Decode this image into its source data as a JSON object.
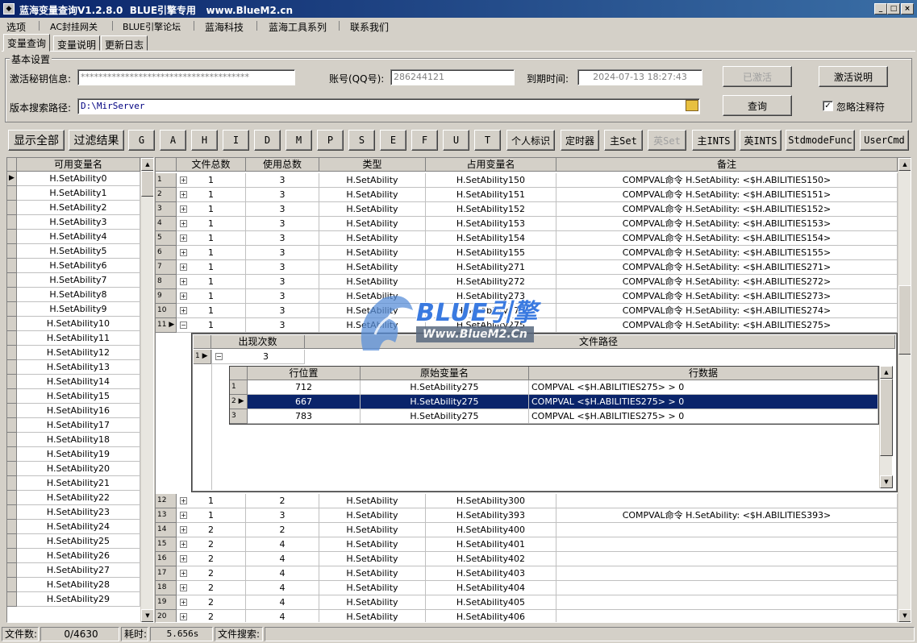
{
  "window": {
    "title": "蓝海变量查询V1.2.8.0  BLUE引擎专用   www.BlueM2.cn",
    "icon": "app-icon",
    "buttons": [
      "minimize-icon",
      "maximize-icon",
      "close-icon"
    ]
  },
  "menu": [
    "选项",
    "AC封挂网关",
    "BLUE引擎论坛",
    "蓝海科技",
    "蓝海工具系列",
    "联系我们"
  ],
  "tabs": [
    "变量查询",
    "变量说明",
    "更新日志"
  ],
  "settings": {
    "group_title": "基本设置",
    "secret_label": "激活秘钥信息:",
    "secret_value": "**************************************",
    "account_label": "账号(QQ号):",
    "account_value": "286244121",
    "expire_label": "到期时间:",
    "expire_value": "2024-07-13 18:27:43",
    "activated_button": "已激活",
    "activation_help_button": "激活说明",
    "path_label": "版本搜索路径:",
    "path_value": "D:\\MirServer",
    "query_button": "查询",
    "ignore_comments_label": "忽略注释符",
    "ignore_comments_checked": true
  },
  "toolbar": [
    "显示全部",
    "过滤结果",
    "G",
    "A",
    "H",
    "I",
    "D",
    "M",
    "P",
    "S",
    "E",
    "F",
    "U",
    "T",
    "个人标识",
    "定时器",
    "主Set",
    "英Set",
    "主INTS",
    "英INTS",
    "StdmodeFunc",
    "UserCmd"
  ],
  "var_list": {
    "header": "可用变量名",
    "items": [
      "H.SetAbility0",
      "H.SetAbility1",
      "H.SetAbility2",
      "H.SetAbility3",
      "H.SetAbility4",
      "H.SetAbility5",
      "H.SetAbility6",
      "H.SetAbility7",
      "H.SetAbility8",
      "H.SetAbility9",
      "H.SetAbility10",
      "H.SetAbility11",
      "H.SetAbility12",
      "H.SetAbility13",
      "H.SetAbility14",
      "H.SetAbility15",
      "H.SetAbility16",
      "H.SetAbility17",
      "H.SetAbility18",
      "H.SetAbility19",
      "H.SetAbility20",
      "H.SetAbility21",
      "H.SetAbility22",
      "H.SetAbility23",
      "H.SetAbility24",
      "H.SetAbility25",
      "H.SetAbility26",
      "H.SetAbility27",
      "H.SetAbility28",
      "H.SetAbility29"
    ]
  },
  "main_grid": {
    "headers": [
      "文件总数",
      "使用总数",
      "类型",
      "占用变量名",
      "备注"
    ],
    "rows_top": [
      [
        "1",
        "1",
        "3",
        "H.SetAbility",
        "H.SetAbility150",
        "COMPVAL命令 H.SetAbility: <$H.ABILITIES150>"
      ],
      [
        "2",
        "1",
        "3",
        "H.SetAbility",
        "H.SetAbility151",
        "COMPVAL命令 H.SetAbility: <$H.ABILITIES151>"
      ],
      [
        "3",
        "1",
        "3",
        "H.SetAbility",
        "H.SetAbility152",
        "COMPVAL命令 H.SetAbility: <$H.ABILITIES152>"
      ],
      [
        "4",
        "1",
        "3",
        "H.SetAbility",
        "H.SetAbility153",
        "COMPVAL命令 H.SetAbility: <$H.ABILITIES153>"
      ],
      [
        "5",
        "1",
        "3",
        "H.SetAbility",
        "H.SetAbility154",
        "COMPVAL命令 H.SetAbility: <$H.ABILITIES154>"
      ],
      [
        "6",
        "1",
        "3",
        "H.SetAbility",
        "H.SetAbility155",
        "COMPVAL命令 H.SetAbility: <$H.ABILITIES155>"
      ],
      [
        "7",
        "1",
        "3",
        "H.SetAbility",
        "H.SetAbility271",
        "COMPVAL命令 H.SetAbility: <$H.ABILITIES271>"
      ],
      [
        "8",
        "1",
        "3",
        "H.SetAbility",
        "H.SetAbility272",
        "COMPVAL命令 H.SetAbility: <$H.ABILITIES272>"
      ],
      [
        "9",
        "1",
        "3",
        "H.SetAbility",
        "H.SetAbility273",
        "COMPVAL命令 H.SetAbility: <$H.ABILITIES273>"
      ],
      [
        "10",
        "1",
        "3",
        "H.SetAbility",
        "H.SetAbility274",
        "COMPVAL命令 H.SetAbility: <$H.ABILITIES274>"
      ],
      [
        "11",
        "1",
        "3",
        "H.SetAbility",
        "H.SetAbility275",
        "COMPVAL命令 H.SetAbility: <$H.ABILITIES275>"
      ]
    ],
    "detail": {
      "headers": [
        "出现次数",
        "文件路径"
      ],
      "row": [
        "1",
        "3"
      ],
      "sub_headers": [
        "行位置",
        "原始变量名",
        "行数据"
      ],
      "sub_rows": [
        [
          "1",
          "712",
          "H.SetAbility275",
          "COMPVAL <$H.ABILITIES275> > 0"
        ],
        [
          "2",
          "667",
          "H.SetAbility275",
          "COMPVAL <$H.ABILITIES275> > 0"
        ],
        [
          "3",
          "783",
          "H.SetAbility275",
          "COMPVAL <$H.ABILITIES275> > 0"
        ]
      ]
    },
    "rows_bottom": [
      [
        "12",
        "1",
        "2",
        "H.SetAbility",
        "H.SetAbility300",
        ""
      ],
      [
        "13",
        "1",
        "3",
        "H.SetAbility",
        "H.SetAbility393",
        "COMPVAL命令 H.SetAbility: <$H.ABILITIES393>"
      ],
      [
        "14",
        "2",
        "2",
        "H.SetAbility",
        "H.SetAbility400",
        ""
      ],
      [
        "15",
        "2",
        "4",
        "H.SetAbility",
        "H.SetAbility401",
        ""
      ],
      [
        "16",
        "2",
        "4",
        "H.SetAbility",
        "H.SetAbility402",
        ""
      ],
      [
        "17",
        "2",
        "4",
        "H.SetAbility",
        "H.SetAbility403",
        ""
      ],
      [
        "18",
        "2",
        "4",
        "H.SetAbility",
        "H.SetAbility404",
        ""
      ],
      [
        "19",
        "2",
        "4",
        "H.SetAbility",
        "H.SetAbility405",
        ""
      ],
      [
        "20",
        "2",
        "4",
        "H.SetAbility",
        "H.SetAbility406",
        ""
      ]
    ]
  },
  "watermark": {
    "brand": "BLUE引擎",
    "url": "Www.BlueM2.Cn"
  },
  "status": {
    "files_label": "文件数:",
    "files_value": "0/4630",
    "time_label": "耗时:",
    "time_value": "5.656s",
    "search_label": "文件搜索:"
  }
}
